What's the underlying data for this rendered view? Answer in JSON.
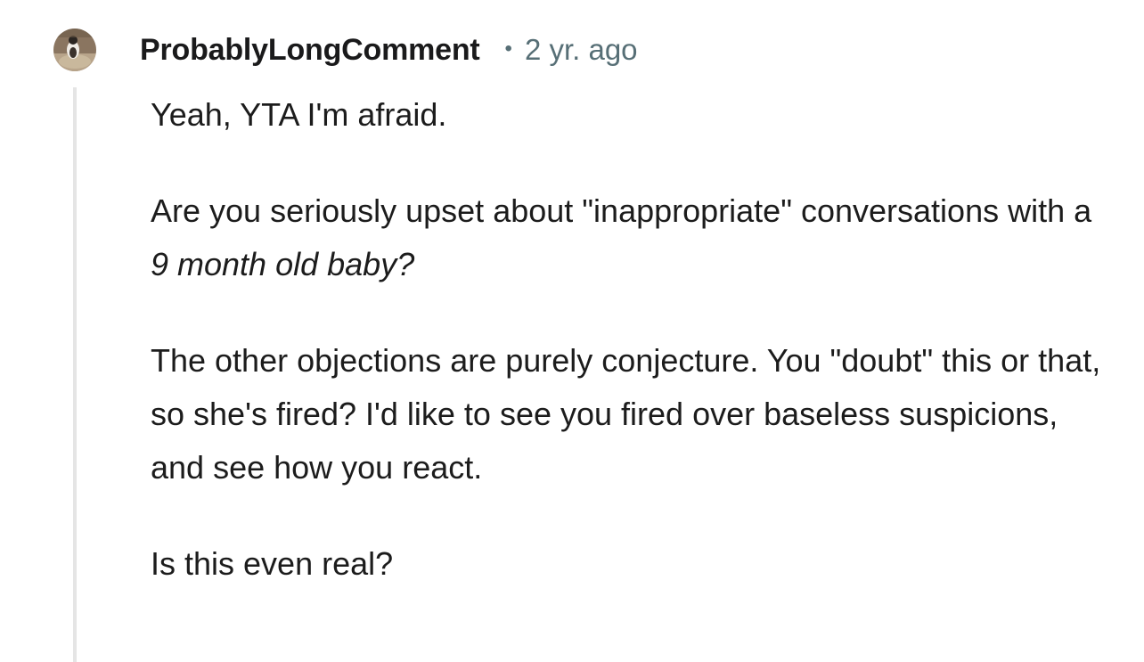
{
  "comment": {
    "author": "ProbablyLongComment",
    "separator": "•",
    "timestamp": "2 yr. ago",
    "avatar_icon": "user-avatar-icon",
    "paragraphs": {
      "p1": "Yeah, YTA I'm afraid.",
      "p2_before": "Are you seriously upset about \"inappropriate\" conversations with a ",
      "p2_italic": "9 month old baby?",
      "p3": "The other objections are purely conjecture. You \"doubt\" this or that, so she's fired? I'd like to see you fired over baseless suspicions, and see how you react.",
      "p4": "Is this even real?"
    }
  },
  "colors": {
    "text": "#1c1c1c",
    "meta": "#576f76",
    "thread_line": "#e5e5e5"
  }
}
